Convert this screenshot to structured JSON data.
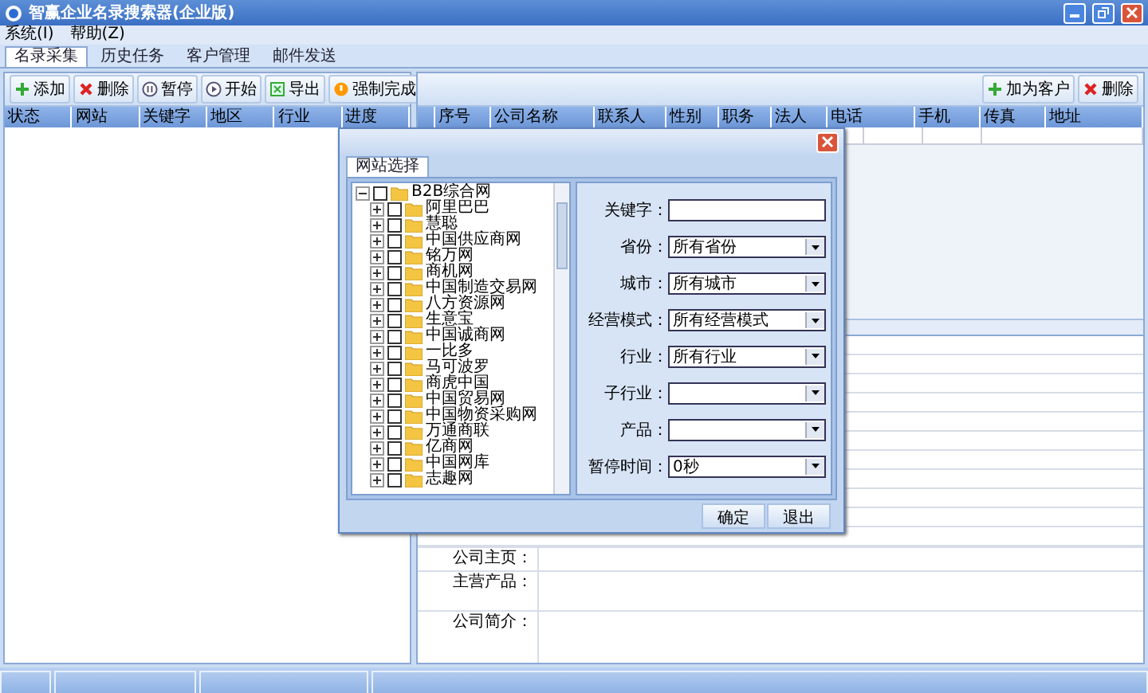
{
  "window": {
    "title": "智赢企业名录搜索器(企业版)"
  },
  "menu": [
    "系统(I)",
    "帮助(Z)"
  ],
  "tabs": [
    {
      "label": "名录采集",
      "selected": true
    },
    {
      "label": "历史任务",
      "selected": false
    },
    {
      "label": "客户管理",
      "selected": false
    },
    {
      "label": "邮件发送",
      "selected": false
    }
  ],
  "task_toolbar": [
    "添加",
    "删除",
    "暂停",
    "开始",
    "导出",
    "强制完成"
  ],
  "task_table": {
    "columns": [
      "状态",
      "网站",
      "关键字",
      "地区",
      "行业",
      "进度"
    ]
  },
  "result_toolbar": [
    "加为客户",
    "删除"
  ],
  "result_table": {
    "columns": [
      "序号",
      "公司名称",
      "联系人",
      "性别",
      "职务",
      "法人",
      "电话",
      "手机",
      "传真",
      "地址"
    ]
  },
  "detail_form": {
    "fields": [
      "公司主页：",
      "主营产品：",
      "公司简介："
    ]
  },
  "dialog": {
    "tab": {
      "label": "网站选择",
      "selected": true
    },
    "tree": {
      "label": "B2B综合网",
      "checked": false,
      "expanded": true,
      "children": [
        {
          "label": "阿里巴巴",
          "checked": false,
          "expanded": false
        },
        {
          "label": "慧聪",
          "checked": false,
          "expanded": false
        },
        {
          "label": "中国供应商网",
          "checked": false,
          "expanded": false
        },
        {
          "label": "铭万网",
          "checked": false,
          "expanded": false
        },
        {
          "label": "商机网",
          "checked": false,
          "expanded": false
        },
        {
          "label": "中国制造交易网",
          "checked": false,
          "expanded": false
        },
        {
          "label": "八方资源网",
          "checked": false,
          "expanded": false
        },
        {
          "label": "生意宝",
          "checked": false,
          "expanded": false
        },
        {
          "label": "中国诚商网",
          "checked": false,
          "expanded": false
        },
        {
          "label": "一比多",
          "checked": false,
          "expanded": false
        },
        {
          "label": "马可波罗",
          "checked": false,
          "expanded": false
        },
        {
          "label": "商虎中国",
          "checked": false,
          "expanded": false
        },
        {
          "label": "中国贸易网",
          "checked": false,
          "expanded": false
        },
        {
          "label": "中国物资采购网",
          "checked": false,
          "expanded": false
        },
        {
          "label": "万通商联",
          "checked": false,
          "expanded": false
        },
        {
          "label": "亿商网",
          "checked": false,
          "expanded": false
        },
        {
          "label": "中国网库",
          "checked": false,
          "expanded": false
        },
        {
          "label": "志趣网",
          "checked": false,
          "expanded": false
        }
      ]
    },
    "fields": [
      {
        "label": "关键字：",
        "kind": "text"
      },
      {
        "label": "省份：",
        "kind": "select",
        "value": "所有省份"
      },
      {
        "label": "城市：",
        "kind": "select",
        "value": "所有城市"
      },
      {
        "label": "经营模式：",
        "kind": "select",
        "value": "所有经营模式"
      },
      {
        "label": "行业：",
        "kind": "select",
        "value": "所有行业"
      },
      {
        "label": "子行业：",
        "kind": "select"
      },
      {
        "label": "产品：",
        "kind": "select"
      },
      {
        "label": "暂停时间：",
        "kind": "select",
        "value": "0秒"
      }
    ],
    "buttons": [
      "确定",
      "退出"
    ]
  }
}
